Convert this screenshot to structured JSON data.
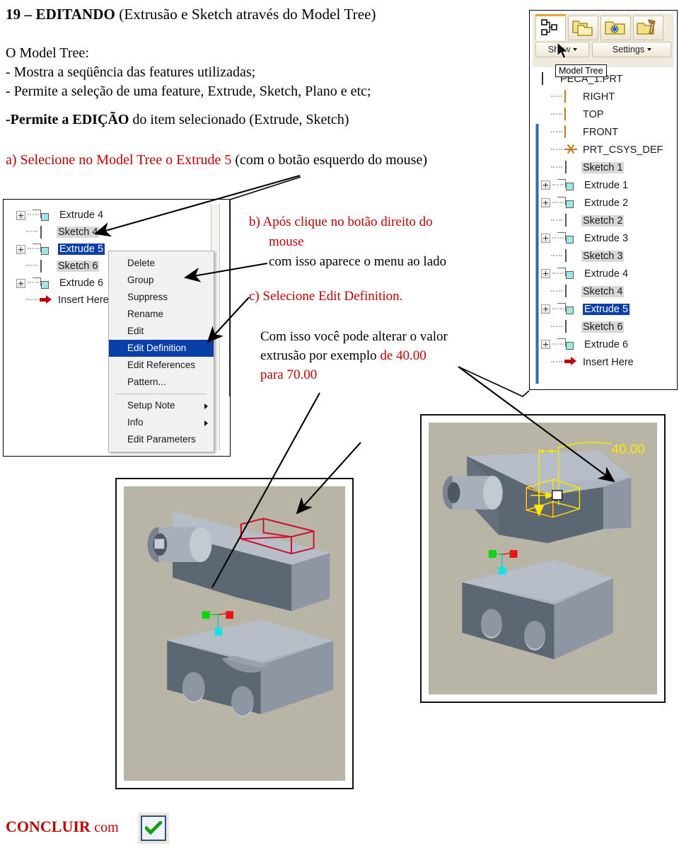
{
  "slide": {
    "title_number": "19 – ",
    "title_bold": "EDITANDO",
    "title_rest": " (Extrusão e Sketch através do Model Tree)",
    "intro_line1": "O Model Tree:",
    "intro_line2": "- Mostra a seqüência das features utilizadas;",
    "intro_line3": "- Permite a seleção de uma feature, Extrude, Sketch, Plano e etc;",
    "permite_dash": "-",
    "permite_bold": "Permite a EDIÇÃO",
    "permite_rest": " do item selecionado (Extrude, Sketch)",
    "step_a_red": "a) Selecione no Model Tree o Extrude 5",
    "step_a_black": " (com o botão esquerdo do mouse)",
    "step_b_red_l1": "b) Após clique no botão direito do",
    "step_b_red_l2": "mouse",
    "step_b_black": "com isso aparece o menu ao lado",
    "step_c": "c) Selecione Edit Definition.",
    "note_black_1": "Com isso você pode alterar o valor",
    "note_black_2": "extrusão por exemplo ",
    "note_red_1": "de 40.00",
    "note_red_2": "para 70.00",
    "concluir": "CONCLUIR",
    "concluir_com": "com",
    "ok_icon": "check-icon"
  },
  "colors": {
    "red_text": "#C00000",
    "selection_blue": "#0B3FA8",
    "insert_here_red": "#C00000",
    "dimension_yellow": "#FFFF00",
    "sketch_outline_red": "#CC1030",
    "model_gray": "#9AA3AD",
    "viewport_bg": "#B9B5A6"
  },
  "left_panel": {
    "name": "model-tree-context-panel",
    "tree": [
      {
        "label": "Extrude 4",
        "icon": "extrude-icon",
        "expandable": true,
        "selected": false,
        "shaded": false
      },
      {
        "label": "Sketch 4",
        "icon": "sketch-icon",
        "expandable": false,
        "selected": false,
        "shaded": true
      },
      {
        "label": "Extrude 5",
        "icon": "extrude-icon",
        "expandable": true,
        "selected": true,
        "shaded": false
      },
      {
        "label": "Sketch 6",
        "icon": "sketch-icon",
        "expandable": false,
        "selected": false,
        "shaded": true
      },
      {
        "label": "Extrude 6",
        "icon": "extrude-icon",
        "expandable": true,
        "selected": false,
        "shaded": false
      },
      {
        "label": "Insert Here",
        "icon": "insert-here-icon",
        "expandable": false,
        "selected": false,
        "shaded": false
      }
    ],
    "context_menu": [
      {
        "label": "Delete",
        "highlighted": false,
        "submenu": false,
        "separator_after": false
      },
      {
        "label": "Group",
        "highlighted": false,
        "submenu": false,
        "separator_after": false
      },
      {
        "label": "Suppress",
        "highlighted": false,
        "submenu": false,
        "separator_after": false
      },
      {
        "label": "Rename",
        "highlighted": false,
        "submenu": false,
        "separator_after": false
      },
      {
        "label": "Edit",
        "highlighted": false,
        "submenu": false,
        "separator_after": false
      },
      {
        "label": "Edit Definition",
        "highlighted": true,
        "submenu": false,
        "separator_after": false
      },
      {
        "label": "Edit References",
        "highlighted": false,
        "submenu": false,
        "separator_after": false
      },
      {
        "label": "Pattern...",
        "highlighted": false,
        "submenu": false,
        "separator_after": true
      },
      {
        "label": "Setup Note",
        "highlighted": false,
        "submenu": true,
        "separator_after": false
      },
      {
        "label": "Info",
        "highlighted": false,
        "submenu": true,
        "separator_after": false
      },
      {
        "label": "Edit Parameters",
        "highlighted": false,
        "submenu": false,
        "separator_after": false
      }
    ]
  },
  "right_panel": {
    "name": "model-tree-window",
    "tabs": [
      {
        "icon": "model-tree-icon",
        "active": true
      },
      {
        "icon": "folder-copy-icon",
        "active": false
      },
      {
        "icon": "folder-star-icon",
        "active": false
      },
      {
        "icon": "folder-tools-icon",
        "active": false
      }
    ],
    "buttons": [
      {
        "label": "Show",
        "icon": "chevron-down-icon"
      },
      {
        "label": "Settings",
        "icon": "chevron-down-icon"
      }
    ],
    "tooltip": "Model Tree",
    "cursor": "mouse-pointer-icon",
    "tree": [
      {
        "label": "PECA_1.PRT",
        "icon": "part-icon",
        "indent": 0,
        "expandable": false,
        "selected": false,
        "shaded": false
      },
      {
        "label": "RIGHT",
        "icon": "plane-icon",
        "indent": 1,
        "expandable": false,
        "selected": false,
        "shaded": false
      },
      {
        "label": "TOP",
        "icon": "plane-icon",
        "indent": 1,
        "expandable": false,
        "selected": false,
        "shaded": false
      },
      {
        "label": "FRONT",
        "icon": "plane-icon",
        "indent": 1,
        "expandable": false,
        "selected": false,
        "shaded": false
      },
      {
        "label": "PRT_CSYS_DEF",
        "icon": "csys-icon",
        "indent": 1,
        "expandable": false,
        "selected": false,
        "shaded": false
      },
      {
        "label": "Sketch 1",
        "icon": "sketch-icon",
        "indent": 1,
        "expandable": false,
        "selected": false,
        "shaded": true
      },
      {
        "label": "Extrude 1",
        "icon": "extrude-icon",
        "indent": 1,
        "expandable": true,
        "selected": false,
        "shaded": false
      },
      {
        "label": "Extrude 2",
        "icon": "extrude-icon",
        "indent": 1,
        "expandable": true,
        "selected": false,
        "shaded": false
      },
      {
        "label": "Sketch 2",
        "icon": "sketch-icon",
        "indent": 1,
        "expandable": false,
        "selected": false,
        "shaded": true
      },
      {
        "label": "Extrude 3",
        "icon": "extrude-icon",
        "indent": 1,
        "expandable": true,
        "selected": false,
        "shaded": false
      },
      {
        "label": "Sketch 3",
        "icon": "sketch-icon",
        "indent": 1,
        "expandable": false,
        "selected": false,
        "shaded": true
      },
      {
        "label": "Extrude 4",
        "icon": "extrude-icon",
        "indent": 1,
        "expandable": true,
        "selected": false,
        "shaded": false
      },
      {
        "label": "Sketch 4",
        "icon": "sketch-icon",
        "indent": 1,
        "expandable": false,
        "selected": false,
        "shaded": true
      },
      {
        "label": "Extrude 5",
        "icon": "extrude-icon",
        "indent": 1,
        "expandable": true,
        "selected": true,
        "shaded": false
      },
      {
        "label": "Sketch 6",
        "icon": "sketch-icon",
        "indent": 1,
        "expandable": false,
        "selected": false,
        "shaded": true
      },
      {
        "label": "Extrude 6",
        "icon": "extrude-icon",
        "indent": 1,
        "expandable": true,
        "selected": false,
        "shaded": false
      },
      {
        "label": "Insert Here",
        "icon": "insert-here-icon",
        "indent": 1,
        "expandable": false,
        "selected": false,
        "shaded": false
      }
    ]
  },
  "viewports": {
    "left": {
      "name": "model-viewport-sketch-highlight",
      "top_model": "block-with-boss-and-red-pocket-outline",
      "bottom_model": "block-with-two-holes-and-slot"
    },
    "right": {
      "name": "model-viewport-edit-definition",
      "dimension_label": "40.00",
      "top_model": "block-with-boss-and-yellow-extrude-handles",
      "bottom_model": "block-with-two-holes"
    }
  }
}
